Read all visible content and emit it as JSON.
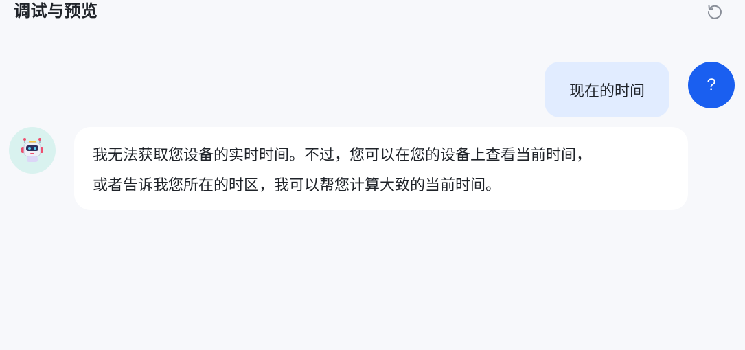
{
  "header": {
    "title": "调试与预览",
    "reset_icon": "reset-icon"
  },
  "messages": [
    {
      "role": "user",
      "avatar_text": "?",
      "text": "现在的时间"
    },
    {
      "role": "bot",
      "avatar_icon": "robot-icon",
      "lines": [
        "我无法获取您设备的实时时间。不过，您可以在您的设备上查看当前时间，",
        "或者告诉我您所在的时区，我可以帮您计算大致的当前时间。"
      ]
    }
  ],
  "colors": {
    "background": "#f7f8fb",
    "user_bubble": "#e1ecff",
    "user_avatar": "#1a5ff0",
    "bot_avatar_bg": "#d9f2ef",
    "bot_bubble": "#ffffff"
  }
}
